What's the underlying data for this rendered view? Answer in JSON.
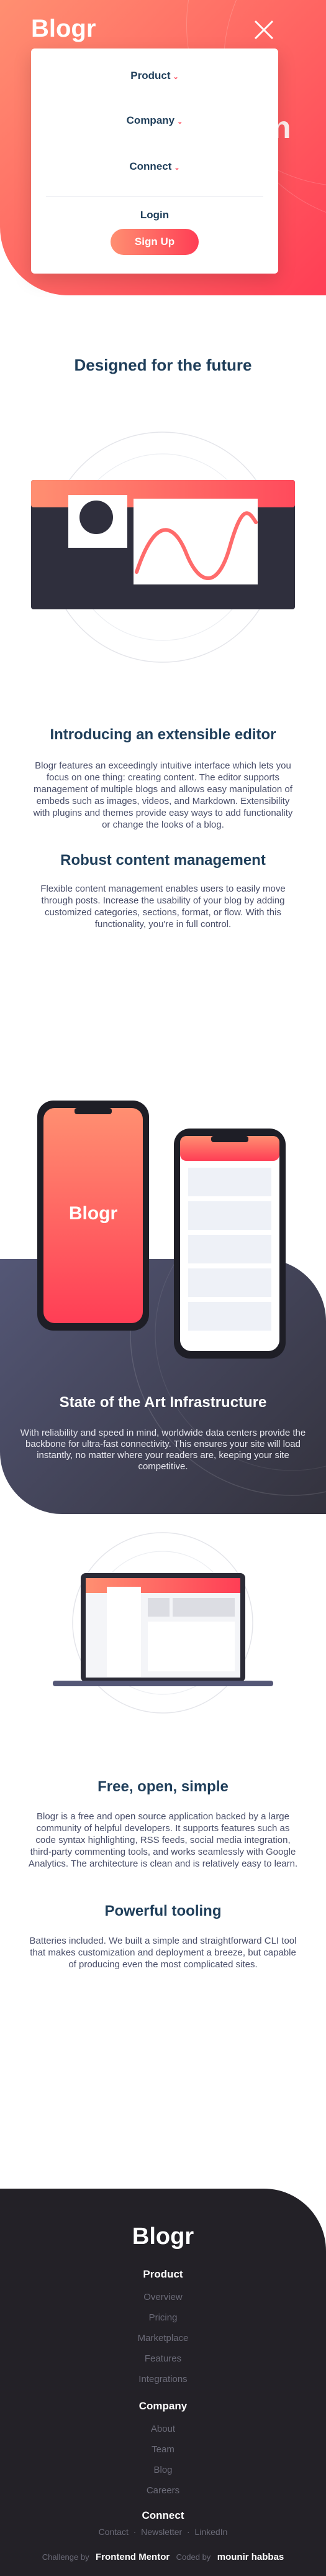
{
  "header": {
    "logo": "Blogr",
    "hero_peek": "n"
  },
  "mobile_menu": {
    "items": [
      {
        "label": "Product"
      },
      {
        "label": "Company"
      },
      {
        "label": "Connect"
      }
    ],
    "login": "Login",
    "signup": "Sign Up"
  },
  "features": {
    "title": "Designed for the future",
    "editor": {
      "title": "Introducing an extensible editor",
      "body": "Blogr features an exceedingly intuitive interface which lets you focus on one thing: creating content. The editor supports management of multiple blogs and allows easy manipulation of embeds such as images, videos, and Markdown. Extensibility with plugins and themes provide easy ways to add functionality or change the looks of a blog."
    },
    "content": {
      "title": "Robust content management",
      "body": "Flexible content management enables users to easily move through posts. Increase the usability of your blog by adding customized categories, sections, format, or flow. With this functionality, you're in full control."
    }
  },
  "infrastructure": {
    "phone_logo": "Blogr",
    "title": "State of the Art Infrastructure",
    "body": "With reliability and speed in mind, worldwide data centers provide the backbone for ultra-fast connectivity. This ensures your site will load instantly, no matter where your readers are, keeping your site competitive."
  },
  "free": {
    "title": "Free, open, simple",
    "body": "Blogr is a free and open source application backed by a large community of helpful developers. It supports features such as code syntax highlighting, RSS feeds, social media integration, third-party commenting tools, and works seamlessly with Google Analytics. The architecture is clean and is relatively easy to learn."
  },
  "tooling": {
    "title": "Powerful tooling",
    "body": "Batteries included. We built a simple and straightforward CLI tool that makes customization and deployment a breeze, but capable of producing even the most complicated sites."
  },
  "footer": {
    "logo": "Blogr",
    "columns": [
      {
        "heading": "Product",
        "links": [
          "Overview",
          "Pricing",
          "Marketplace",
          "Features",
          "Integrations"
        ]
      },
      {
        "heading": "Company",
        "links": [
          "About",
          "Team",
          "Blog",
          "Careers"
        ]
      },
      {
        "heading": "Connect",
        "links": [
          "Contact",
          "Newsletter",
          "LinkedIn"
        ]
      }
    ],
    "attribution": {
      "challenge_by": "Challenge by",
      "frontend_mentor": "Frontend Mentor",
      "coded_by": "Coded by",
      "author": "mounir habbas"
    }
  },
  "colors": {
    "accent_start": "#ff8f71",
    "accent_end": "#ff3e55",
    "heading": "#1f3e5a",
    "dark_panel": "#545776",
    "footer_bg": "#232127"
  },
  "icons": [
    "close-icon",
    "chevron-down-icon"
  ]
}
